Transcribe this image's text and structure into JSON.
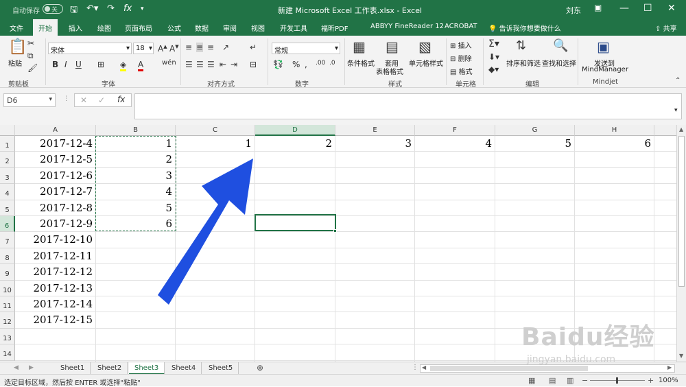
{
  "titlebar": {
    "autosave_label": "自动保存",
    "autosave_state": "关",
    "title": "新建 Microsoft Excel 工作表.xlsx - Excel",
    "user": "刘东"
  },
  "tabs": [
    "文件",
    "开始",
    "插入",
    "绘图",
    "页面布局",
    "公式",
    "数据",
    "审阅",
    "视图",
    "开发工具",
    "福昕PDF",
    "ABBYY FineReader 12",
    "ACROBAT"
  ],
  "active_tab": "开始",
  "tell_me": "告诉我你想要做什么",
  "share": "共享",
  "ribbon": {
    "paste": "粘贴",
    "clipboard": "剪贴板",
    "font_name": "宋体",
    "font_size": "18",
    "font_group": "字体",
    "align_group": "对齐方式",
    "number_format": "常规",
    "number_group": "数字",
    "cond_format": "条件格式",
    "table_format_1": "套用",
    "table_format_2": "表格格式",
    "cell_styles": "单元格样式",
    "styles_group": "样式",
    "insert": "插入",
    "delete": "删除",
    "format": "格式",
    "cells_group": "单元格",
    "sort_filter": "排序和筛选",
    "find_select": "查找和选择",
    "edit_group": "编辑",
    "send_to": "发送到",
    "mindmanager": "MindManager",
    "mindjet": "Mindjet"
  },
  "namebox": "D6",
  "columns": [
    "A",
    "B",
    "C",
    "D",
    "E",
    "F",
    "G",
    "H"
  ],
  "rows": [
    "1",
    "2",
    "3",
    "4",
    "5",
    "6",
    "7",
    "8",
    "9",
    "10",
    "11",
    "12",
    "13",
    "14"
  ],
  "colA": [
    "2017-12-4",
    "2017-12-5",
    "2017-12-6",
    "2017-12-7",
    "2017-12-8",
    "2017-12-9",
    "2017-12-10",
    "2017-12-11",
    "2017-12-12",
    "2017-12-13",
    "2017-12-14",
    "2017-12-15"
  ],
  "colB": [
    "1",
    "2",
    "3",
    "4",
    "5",
    "6"
  ],
  "row1_CH": [
    "1",
    "2",
    "3",
    "4",
    "5",
    "6"
  ],
  "sheets": [
    "Sheet1",
    "Sheet2",
    "Sheet3",
    "Sheet4",
    "Sheet5"
  ],
  "active_sheet": "Sheet3",
  "status_message": "选定目标区域，然后按 ENTER 或选择\"粘贴\"",
  "zoom": "100%",
  "watermark_1": "Baidu经验",
  "watermark_2": "jingyan.baidu.com",
  "accent": "#217346",
  "arrow_color": "#1f4fe0"
}
